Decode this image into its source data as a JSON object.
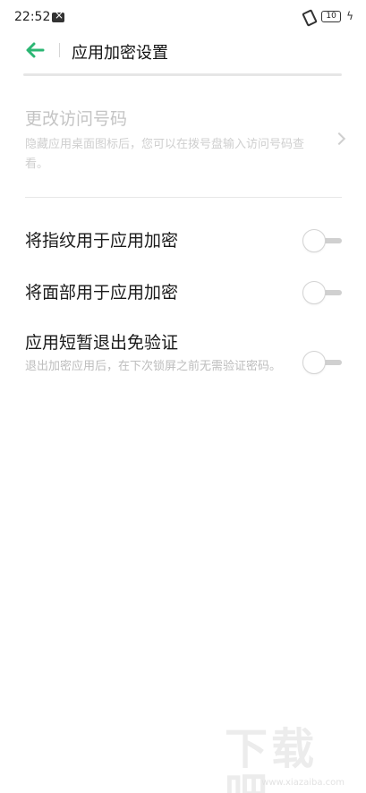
{
  "status_bar": {
    "time": "22:52",
    "battery": "10"
  },
  "header": {
    "title": "应用加密设置"
  },
  "settings": {
    "change_code": {
      "label": "更改访问号码",
      "description": "隐藏应用桌面图标后，您可以在拨号盘输入访问号码查看。"
    },
    "fingerprint": {
      "label": "将指纹用于应用加密",
      "enabled": false
    },
    "face": {
      "label": "将面部用于应用加密",
      "enabled": false
    },
    "short_exit": {
      "label": "应用短暂退出免验证",
      "description": "退出加密应用后，在下次锁屏之前无需验证密码。",
      "enabled": false
    }
  },
  "watermark": {
    "text": "下载吧",
    "url": "www.xiazaiba.com"
  },
  "colors": {
    "accent": "#2bb673",
    "disabled_text": "#c4c4c4",
    "toggle_off": "#d0d0d0"
  }
}
